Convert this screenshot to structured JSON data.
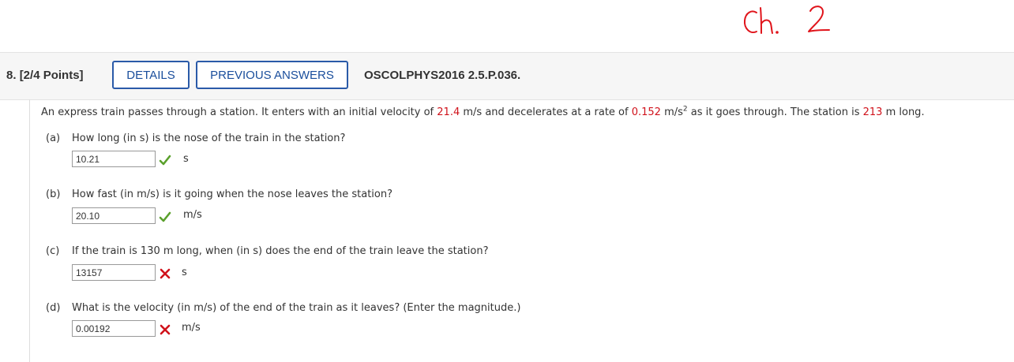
{
  "annotation": {
    "text": "ch. 2",
    "color": "#e0141b"
  },
  "header": {
    "question_number": "8.",
    "points": "[2/4 Points]",
    "details_label": "DETAILS",
    "previous_answers_label": "PREVIOUS ANSWERS",
    "question_code": "OSCOLPHYS2016 2.5.P.036."
  },
  "problem": {
    "text_1": "An express train passes through a station. It enters with an initial velocity of ",
    "velocity": "21.4",
    "text_2": " m/s and decelerates at a rate of ",
    "decel": "0.152",
    "text_3": " m/s",
    "exp": "2",
    "text_4": " as it goes through. The station is ",
    "length": "213",
    "text_5": " m long."
  },
  "parts": [
    {
      "letter": "(a)",
      "question": "How long (in s) is the nose of the train in the station?",
      "answer": "10.21",
      "status": "correct",
      "icon": "checkmark-icon",
      "unit": "s"
    },
    {
      "letter": "(b)",
      "question": "How fast (in m/s) is it going when the nose leaves the station?",
      "answer": "20.10",
      "status": "correct",
      "icon": "checkmark-icon",
      "unit": "m/s"
    },
    {
      "letter": "(c)",
      "question": "If the train is 130 m long, when (in s) does the end of the train leave the station?",
      "answer": "13157",
      "status": "incorrect",
      "icon": "x-mark-icon",
      "unit": "s"
    },
    {
      "letter": "(d)",
      "question": "What is the velocity (in m/s) of the end of the train as it leaves? (Enter the magnitude.)",
      "answer": "0.00192",
      "status": "incorrect",
      "icon": "x-mark-icon",
      "unit": "m/s"
    }
  ],
  "colors": {
    "correct": "#5aa02c",
    "incorrect": "#d0121b",
    "button_border": "#2a5aa8",
    "highlight": "#d0121b"
  }
}
